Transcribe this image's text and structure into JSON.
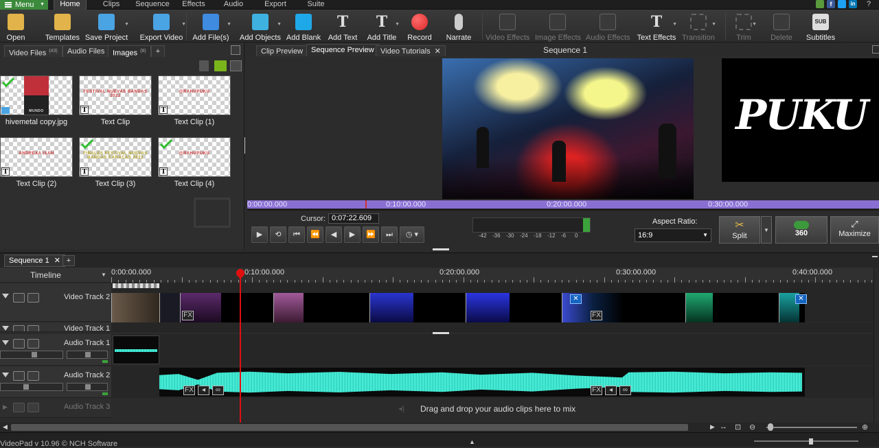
{
  "menubar": {
    "menu_label": "Menu",
    "tabs": [
      "Home",
      "Clips",
      "Sequence",
      "Effects",
      "Audio",
      "Export",
      "Suite"
    ]
  },
  "toolbar": {
    "items": [
      {
        "label": "Open",
        "icon": "folder-icon",
        "color": "#e2b34a",
        "enabled": true
      },
      {
        "label": "Templates",
        "icon": "templates-icon",
        "color": "#e2b34a",
        "enabled": true
      },
      {
        "label": "Save Project",
        "icon": "save-project-icon",
        "color": "#4aa3e2",
        "enabled": true
      },
      {
        "label": "Export Video",
        "icon": "export-video-icon",
        "color": "#4aa3e2",
        "enabled": true
      },
      {
        "label": "Add File(s)",
        "icon": "add-file-icon",
        "color": "#3f8be0",
        "enabled": true
      },
      {
        "label": "Add Objects",
        "icon": "add-objects-icon",
        "color": "#3fb1e0",
        "enabled": true
      },
      {
        "label": "Add Blank",
        "icon": "add-blank-icon",
        "color": "#1fa8e8",
        "enabled": true
      },
      {
        "label": "Add Text",
        "icon": "add-text-icon",
        "color": "#dddddd",
        "enabled": true
      },
      {
        "label": "Add Title",
        "icon": "add-title-icon",
        "color": "#dddddd",
        "enabled": true
      },
      {
        "label": "Record",
        "icon": "record-icon",
        "color": "#d92a2a",
        "enabled": true
      },
      {
        "label": "Narrate",
        "icon": "microphone-icon",
        "color": "#cccccc",
        "enabled": true
      },
      {
        "label": "Video Effects",
        "icon": "video-effects-icon",
        "color": "#666666",
        "enabled": false
      },
      {
        "label": "Image Effects",
        "icon": "image-effects-icon",
        "color": "#666666",
        "enabled": false
      },
      {
        "label": "Audio Effects",
        "icon": "audio-effects-icon",
        "color": "#666666",
        "enabled": false
      },
      {
        "label": "Text Effects",
        "icon": "text-effects-icon",
        "color": "#dddddd",
        "enabled": true
      },
      {
        "label": "Transition",
        "icon": "transition-icon",
        "color": "#666666",
        "enabled": false
      },
      {
        "label": "Trim",
        "icon": "trim-icon",
        "color": "#666666",
        "enabled": false
      },
      {
        "label": "Delete",
        "icon": "delete-icon",
        "color": "#666666",
        "enabled": false
      },
      {
        "label": "Subtitles",
        "icon": "subtitles-icon",
        "color": "#dddddd",
        "enabled": true
      }
    ],
    "subtitles_badge": "SUB"
  },
  "media_panel": {
    "tabs": [
      {
        "label": "Video Files",
        "count": "(43)"
      },
      {
        "label": "Audio Files",
        "count": ""
      },
      {
        "label": "Images",
        "count": "(8)"
      }
    ],
    "add_tab": "+",
    "items": [
      {
        "caption": "hivemetal copy.jpg",
        "checked": true,
        "kind": "image",
        "text": "MUNDO"
      },
      {
        "caption": "Text Clip",
        "checked": false,
        "kind": "text",
        "text": "FESTIVAL NUEVAS BANDAS 2022"
      },
      {
        "caption": "Text Clip (1)",
        "checked": false,
        "kind": "text",
        "text": "@RAHUPUKU"
      },
      {
        "caption": "Text Clip (2)",
        "checked": false,
        "kind": "text",
        "text": "ANDREXA ISAN"
      },
      {
        "caption": "Text Clip (3)",
        "checked": true,
        "kind": "text",
        "text": "FINALES FESTIVAL NUEVAS BANDAS CARACAS 2022"
      },
      {
        "caption": "Text Clip (4)",
        "checked": true,
        "kind": "text",
        "text": "@RAHUPUKU"
      }
    ]
  },
  "preview": {
    "tabs": [
      "Clip Preview",
      "Sequence Preview",
      "Video Tutorials"
    ],
    "title": "Sequence 1",
    "logo_text": "PUKU",
    "ruler": [
      "0:00:00.000",
      "0:10:00.000",
      "0:20:00.000",
      "0:30:00.000"
    ],
    "cursor_label": "Cursor:",
    "cursor_value": "0:07:22.609",
    "meter_labels": [
      "-42",
      "-36",
      "-30",
      "-24",
      "-18",
      "-12",
      "-6",
      "0"
    ],
    "aspect_label": "Aspect Ratio:",
    "aspect_value": "16:9",
    "split_label": "Split",
    "vr_label": "360",
    "maximize_label": "Maximize"
  },
  "sequence": {
    "tab_label": "Sequence 1",
    "add_tab": "+",
    "timeline_label": "Timeline",
    "ruler": [
      "0:00:00.000",
      "0:10:00.000",
      "0:20:00.000",
      "0:30:00.000",
      "0:40:00.000"
    ],
    "tracks": [
      {
        "name": "Video Track 2",
        "type": "video"
      },
      {
        "name": "Video Track 1",
        "type": "video"
      },
      {
        "name": "Audio Track 1",
        "type": "audio"
      },
      {
        "name": "Audio Track 2",
        "type": "audio"
      },
      {
        "name": "Audio Track 3",
        "type": "audio"
      }
    ],
    "drop_hint": "Drag and drop your audio clips here to mix",
    "fx_label": "FX"
  },
  "status": {
    "text": "VideoPad v 10.96 © NCH Software"
  },
  "colors": {
    "accent_green": "#3c8a3c",
    "ruler_purple": "#8a6fd2",
    "waveform": "#41e6d0",
    "playhead": "#e01010"
  }
}
